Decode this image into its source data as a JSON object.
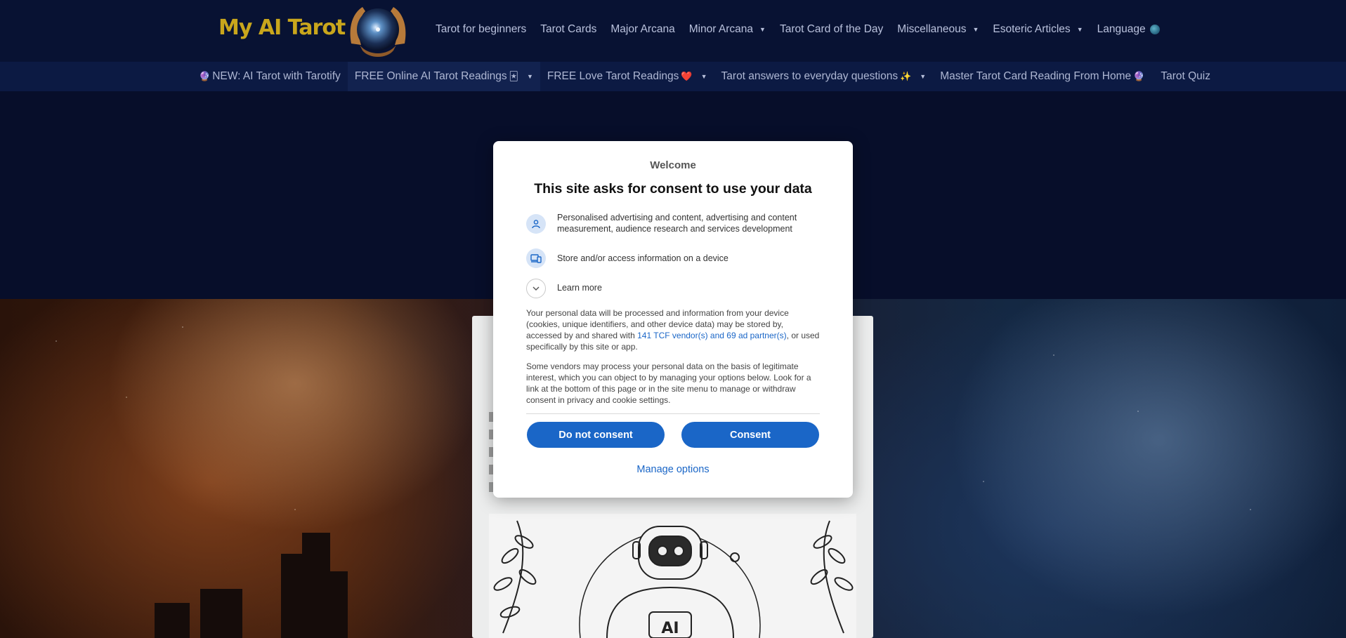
{
  "header": {
    "logo_text": "My AI Tarot",
    "nav": [
      {
        "label": "Tarot for beginners",
        "has_dropdown": false
      },
      {
        "label": "Tarot Cards",
        "has_dropdown": false
      },
      {
        "label": "Major Arcana",
        "has_dropdown": false
      },
      {
        "label": "Minor Arcana",
        "has_dropdown": true
      },
      {
        "label": "Tarot Card of the Day",
        "has_dropdown": false
      },
      {
        "label": "Miscellaneous",
        "has_dropdown": true
      },
      {
        "label": "Esoteric Articles",
        "has_dropdown": true
      },
      {
        "label": "Language",
        "has_dropdown": false
      }
    ]
  },
  "subnav": [
    {
      "label": "NEW: AI Tarot with Tarotify",
      "emoji_before": "🔮",
      "emoji_after": "",
      "has_dropdown": false
    },
    {
      "label": "FREE Online AI Tarot Readings",
      "emoji_before": "",
      "emoji_after": "🃏",
      "has_dropdown": true
    },
    {
      "label": "FREE Love Tarot Readings",
      "emoji_before": "",
      "emoji_after": "❤️",
      "has_dropdown": true
    },
    {
      "label": "Tarot answers to everyday questions",
      "emoji_before": "",
      "emoji_after": "✨",
      "has_dropdown": true
    },
    {
      "label": "Master Tarot Card Reading From Home",
      "emoji_before": "",
      "emoji_after": "🔮",
      "has_dropdown": false
    },
    {
      "label": "Tarot Quiz",
      "emoji_before": "",
      "emoji_after": "",
      "has_dropdown": false
    }
  ],
  "consent": {
    "welcome": "Welcome",
    "title": "This site asks for consent to use your data",
    "purposes": [
      {
        "icon": "person-icon",
        "text": "Personalised advertising and content, advertising and content measurement, audience research and services development"
      },
      {
        "icon": "device-icon",
        "text": "Store and/or access information on a device"
      }
    ],
    "learn_more": "Learn more",
    "para1_before": "Your personal data will be processed and information from your device (cookies, unique identifiers, and other device data) may be stored by, accessed by and shared with ",
    "para1_link": "141 TCF vendor(s) and 69 ad partner(s)",
    "para1_after": ", or used specifically by this site or app.",
    "para2": "Some vendors may process your personal data on the basis of legitimate interest, which you can object to by managing your options below. Look for a link at the bottom of this page or in the site menu to manage or withdraw consent in privacy and cookie settings.",
    "do_not_consent": "Do not consent",
    "consent": "Consent",
    "manage_options": "Manage options"
  },
  "colors": {
    "page_bg": "#070e2a",
    "header_bg": "#081233",
    "logo_gold": "#c9a61c",
    "button_blue": "#1a66c7"
  },
  "illustration_badge": "AI"
}
